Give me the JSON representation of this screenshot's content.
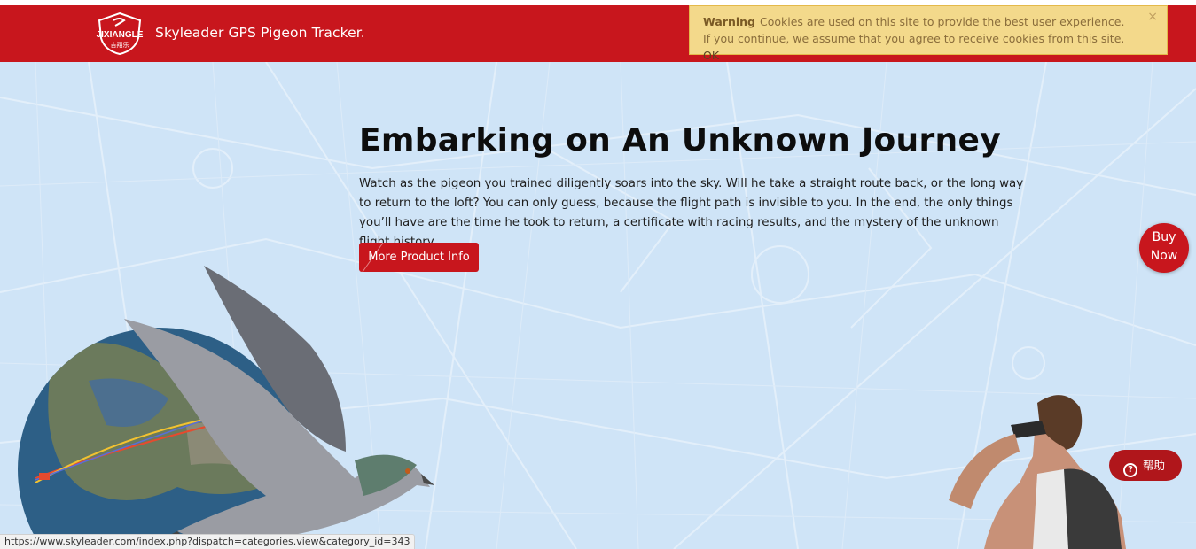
{
  "header": {
    "logo_text_en": "JIXIANGLE",
    "logo_text_cn": "吉翔乐",
    "brand_title": "Skyleader GPS Pigeon Tracker."
  },
  "cookie_notice": {
    "label": "Warning",
    "message": "Cookies are used on this site to provide the best user experience. If you continue, we assume that you agree to receive cookies from this site.",
    "ok_label": "OK",
    "close_label": "×"
  },
  "hero": {
    "title": "Embarking on An Unknown Journey",
    "description": "Watch as the pigeon you trained diligently soars into the sky. Will he take a straight route back, or the long way to return to the loft? You can only guess, because the flight path is invisible to you. In the end, the only things you’ll have are the time he took to return, a certificate with racing results, and the mystery of the unknown flight history",
    "button_label": "More Product Info"
  },
  "buy_now": {
    "line1": "Buy",
    "line2": "Now"
  },
  "help": {
    "label": "帮助",
    "icon": "?"
  },
  "status_bar": {
    "url": "https://www.skyleader.com/index.php?dispatch=categories.view&category_id=343"
  },
  "colors": {
    "brand_red": "#c8161d",
    "hero_bg": "#cfe4f7",
    "cookie_bg": "#f3d98b"
  }
}
